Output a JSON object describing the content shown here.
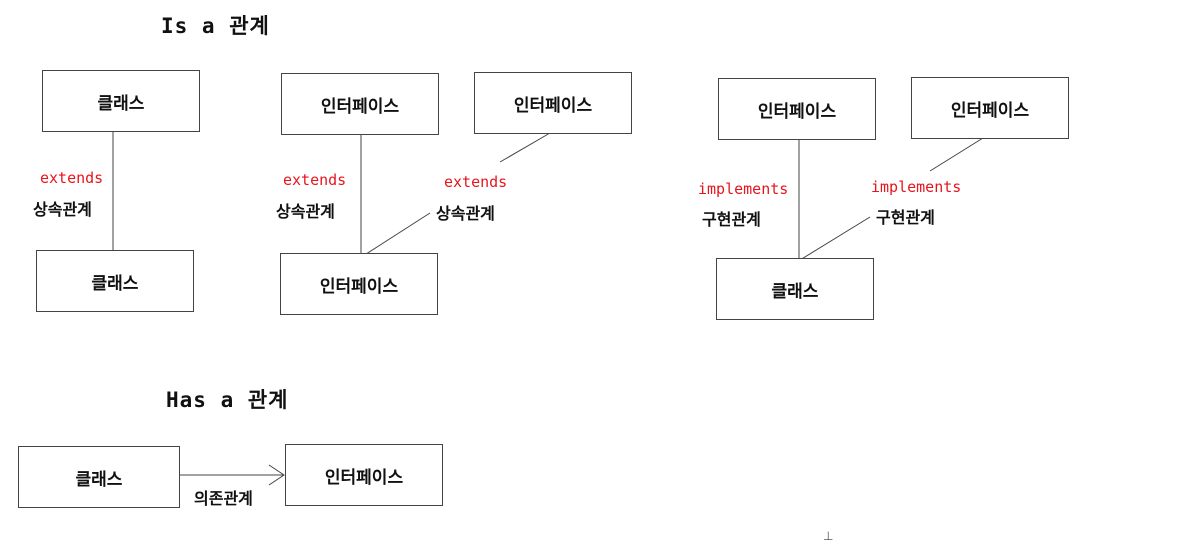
{
  "headings": {
    "is_a": "Is a 관계",
    "has_a": "Has a 관계"
  },
  "colors": {
    "keyword": "#e8141c",
    "text": "#111111",
    "line": "#444444"
  },
  "is_a": {
    "class_extends": {
      "top_box": "클래스",
      "bottom_box": "클래스",
      "keyword": "extends",
      "relation": "상속관계"
    },
    "interface_extends": {
      "left_box": "인터페이스",
      "right_box": "인터페이스",
      "bottom_box": "인터페이스",
      "left_keyword": "extends",
      "left_relation": "상속관계",
      "right_keyword": "extends",
      "right_relation": "상속관계"
    },
    "class_implements": {
      "left_box": "인터페이스",
      "right_box": "인터페이스",
      "bottom_box": "클래스",
      "left_keyword": "implements",
      "left_relation": "구현관계",
      "right_keyword": "implements",
      "right_relation": "구현관계"
    }
  },
  "has_a": {
    "source_box": "클래스",
    "target_box": "인터페이스",
    "relation": "의존관계"
  }
}
